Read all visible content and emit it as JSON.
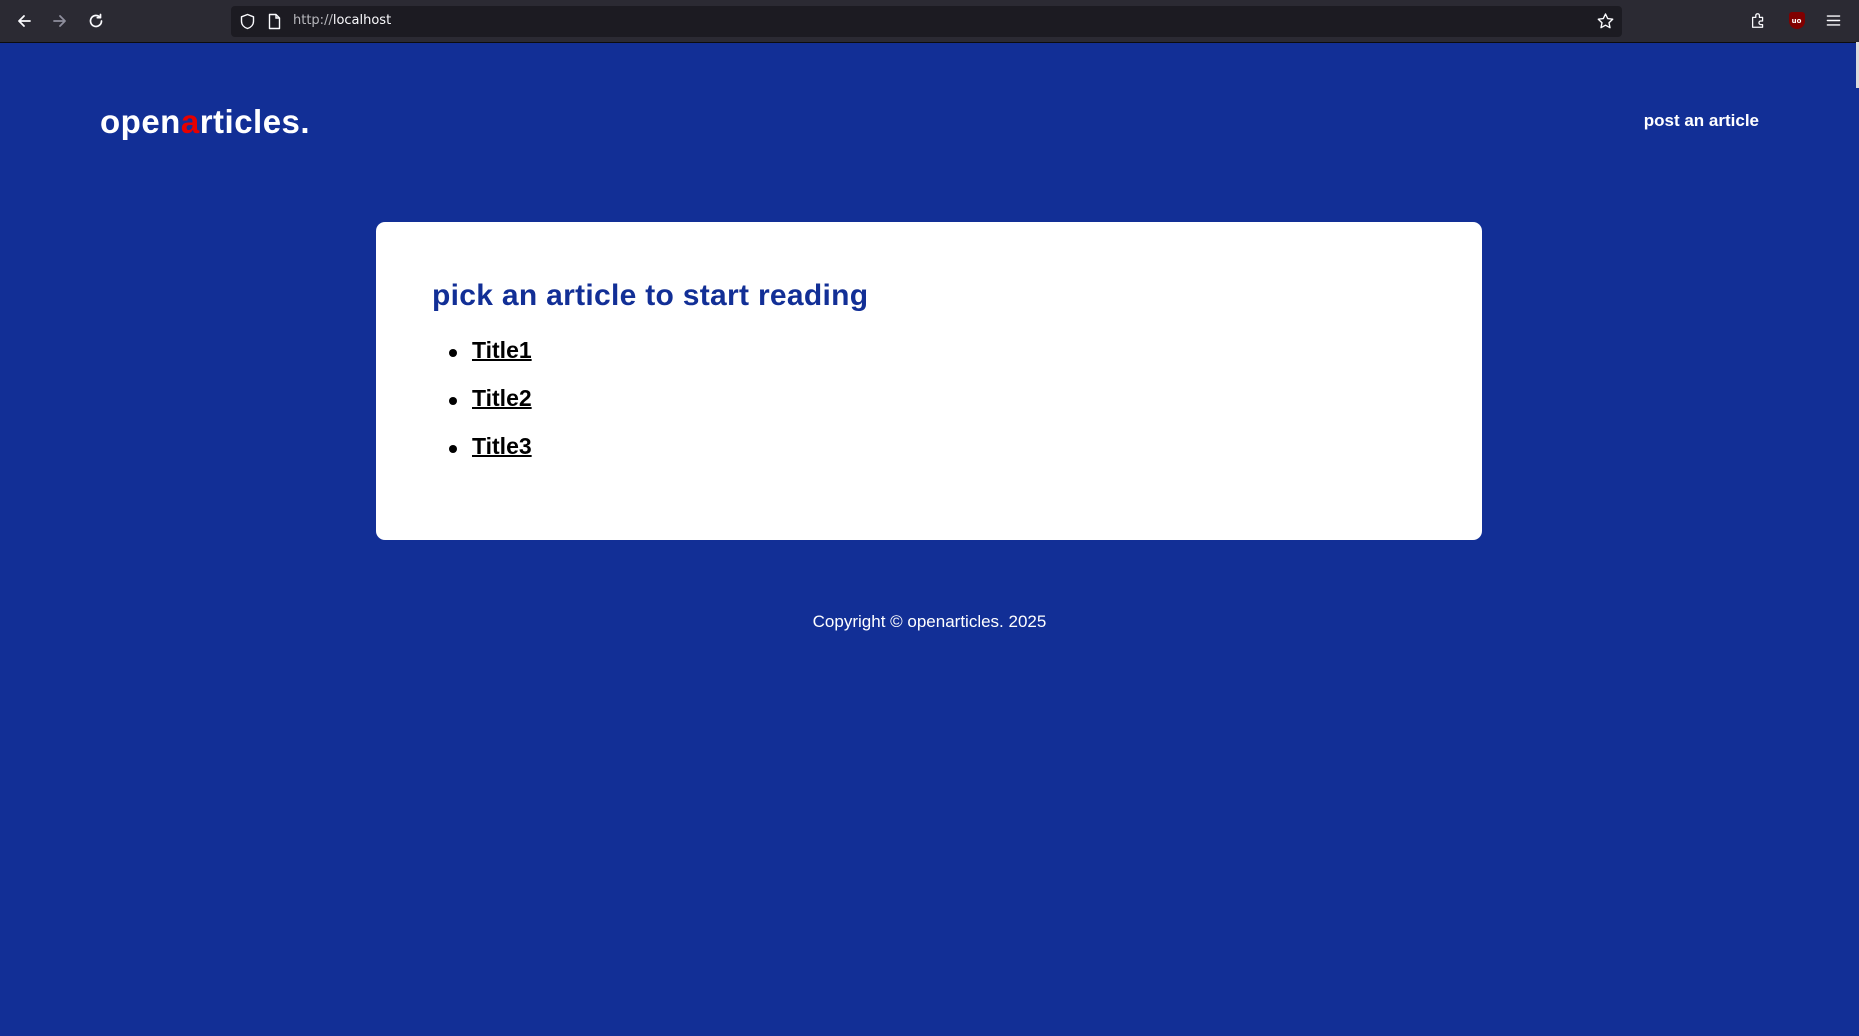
{
  "browser": {
    "url_scheme": "http://",
    "url_host": "localhost",
    "ublock_badge": "uo"
  },
  "site": {
    "logo": {
      "before": "open",
      "accent": "a",
      "after": "rticles."
    },
    "nav_post_label": "post an article"
  },
  "main": {
    "heading": "pick an article to start reading",
    "articles": [
      "Title1",
      "Title2",
      "Title3"
    ]
  },
  "footer": {
    "copyright": "Copyright © openarticles. 2025"
  },
  "colors": {
    "background": "#122f96",
    "logo_accent": "#e60000",
    "card": "#ffffff",
    "heading": "#122f96"
  }
}
